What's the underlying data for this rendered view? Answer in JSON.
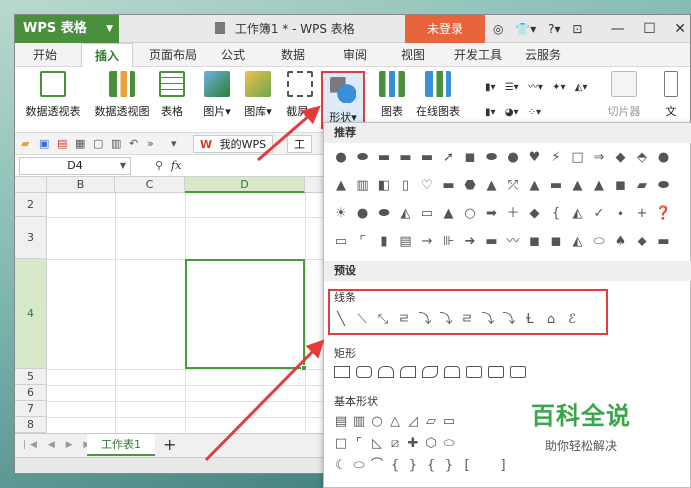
{
  "app": {
    "name": "WPS 表格",
    "doc_title": "工作簿1 * - WPS 表格",
    "login_label": "未登录",
    "titlebar_icons": [
      "◎",
      "👕▾",
      "?▾",
      "⊡"
    ],
    "window_controls": [
      "—",
      "☐",
      "✕"
    ]
  },
  "menu": {
    "tabs": [
      "开始",
      "插入",
      "页面布局",
      "公式",
      "数据",
      "审阅",
      "视图",
      "开发工具",
      "云服务"
    ],
    "active": "插入"
  },
  "ribbon": {
    "buttons": [
      "数据透视表",
      "数据透视图",
      "表格",
      "图片▾",
      "图库▾",
      "截屏▾",
      "形状▾",
      "图表",
      "在线图表",
      "切片器",
      "文"
    ]
  },
  "quickbar": {
    "my_wps": "我的WPS",
    "book_tab": "工"
  },
  "formula": {
    "cell_ref": "D4",
    "fx": "fx"
  },
  "sheet": {
    "columns": [
      "B",
      "C",
      "D"
    ],
    "rows": [
      "2",
      "3",
      "4",
      "5",
      "6",
      "7",
      "8"
    ],
    "tab_label": "工作表1"
  },
  "shapes_panel": {
    "recommend": "推荐",
    "presets": "预设",
    "lines": "线条",
    "rect": "矩形",
    "basic": "基本形状"
  },
  "watermark": {
    "title": "百科全说",
    "subtitle": "助你轻松解决"
  },
  "colors": {
    "wps_green": "#4a8f3c",
    "login_orange": "#e8643c",
    "highlight_red": "#e23c3c",
    "selection_green": "#4a9a3c"
  }
}
